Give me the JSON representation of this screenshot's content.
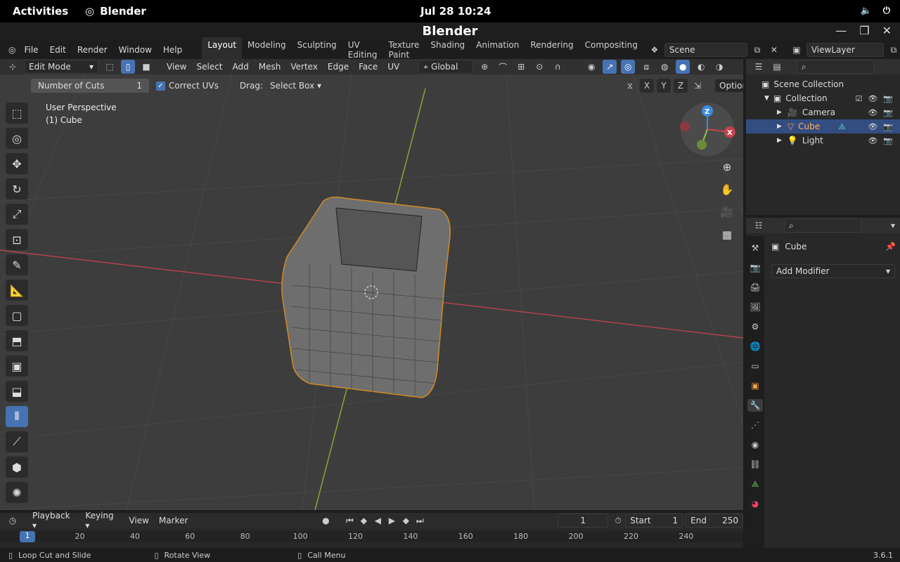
{
  "gnome": {
    "activities": "Activities",
    "app_name": "Blender",
    "clock": "Jul 28  10:24"
  },
  "window": {
    "title": "Blender"
  },
  "menu": {
    "items": [
      "File",
      "Edit",
      "Render",
      "Window",
      "Help"
    ]
  },
  "workspaces": {
    "tabs": [
      "Layout",
      "Modeling",
      "Sculpting",
      "UV Editing",
      "Texture Paint",
      "Shading",
      "Animation",
      "Rendering",
      "Compositing"
    ],
    "active": "Layout"
  },
  "scene": {
    "label": "Scene",
    "viewlayer": "ViewLayer"
  },
  "viewport_header": {
    "mode": "Edit Mode",
    "menus": [
      "View",
      "Select",
      "Add",
      "Mesh",
      "Vertex",
      "Edge",
      "Face",
      "UV"
    ],
    "orientation": "Global"
  },
  "operator": {
    "cuts_label": "Number of Cuts",
    "cuts_value": "1",
    "correct_uvs": "Correct UVs",
    "drag_label": "Drag:",
    "drag_value": "Select Box",
    "axes": [
      "X",
      "Y",
      "Z"
    ],
    "options": "Options"
  },
  "viewport_info": {
    "view": "User Perspective",
    "object": "(1) Cube"
  },
  "gizmo": {
    "x": "X",
    "z": "Z"
  },
  "outliner": {
    "root": "Scene Collection",
    "collection": "Collection",
    "items": [
      {
        "name": "Camera",
        "selected": false
      },
      {
        "name": "Cube",
        "selected": true
      },
      {
        "name": "Light",
        "selected": false
      }
    ]
  },
  "properties": {
    "object": "Cube",
    "add_modifier": "Add Modifier"
  },
  "timeline": {
    "menus": [
      "Playback",
      "Keying",
      "View",
      "Marker"
    ],
    "current_frame": "1",
    "start_label": "Start",
    "start": "1",
    "end_label": "End",
    "end": "250",
    "frame_marker": "1",
    "ruler": [
      {
        "label": "20",
        "value": 20
      },
      {
        "label": "40",
        "value": 40
      },
      {
        "label": "60",
        "value": 60
      },
      {
        "label": "80",
        "value": 80
      },
      {
        "label": "100",
        "value": 100
      },
      {
        "label": "120",
        "value": 120
      },
      {
        "label": "140",
        "value": 140
      },
      {
        "label": "160",
        "value": 160
      },
      {
        "label": "180",
        "value": 180
      },
      {
        "label": "200",
        "value": 200
      },
      {
        "label": "220",
        "value": 220
      },
      {
        "label": "240",
        "value": 240
      }
    ]
  },
  "status": {
    "hint1": "Loop Cut and Slide",
    "hint2": "Rotate View",
    "hint3": "Call Menu",
    "version": "3.6.1"
  },
  "colors": {
    "accent": "#4772b3",
    "selected_row": "#334d80",
    "x_axis": "#c8424c",
    "y_axis": "#8bc34a",
    "z_axis": "#3d8be0"
  }
}
